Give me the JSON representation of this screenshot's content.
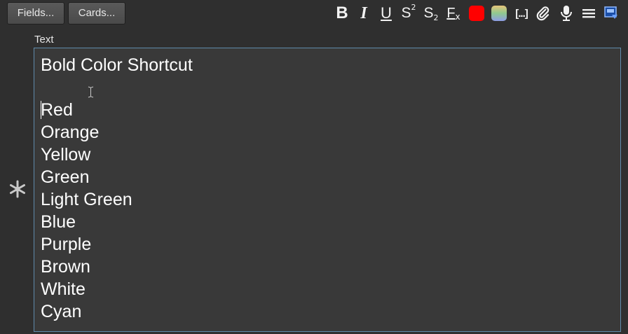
{
  "toolbar": {
    "fields_label": "Fields...",
    "cards_label": "Cards...",
    "bold_glyph": "B",
    "italic_glyph": "I",
    "underline_glyph": "U",
    "superscript_base": "S",
    "superscript_mark": "2",
    "subscript_base": "S",
    "subscript_mark": "2",
    "clear_format_base": "F",
    "clear_format_mark": "x",
    "cloze_glyph": "[...]",
    "text_color": "#ff0000",
    "highlight_colors": [
      "#e7c57a",
      "#8fc98f",
      "#8f9de7"
    ],
    "icons": [
      "bold-icon",
      "italic-icon",
      "underline-icon",
      "superscript-icon",
      "subscript-icon",
      "clear-format-icon",
      "text-color-icon",
      "highlight-color-icon",
      "cloze-icon",
      "attach-icon",
      "microphone-icon",
      "more-icon",
      "html-editor-icon"
    ]
  },
  "field": {
    "label": "Text",
    "sticky_icon": "snowflake-icon",
    "border_color": "#5f8bab",
    "lines": [
      "Bold Color Shortcut",
      "",
      "Red",
      "Orange",
      "Yellow",
      "Green",
      "Light Green",
      "Blue",
      "Purple",
      "Brown",
      "White",
      "Cyan"
    ]
  }
}
